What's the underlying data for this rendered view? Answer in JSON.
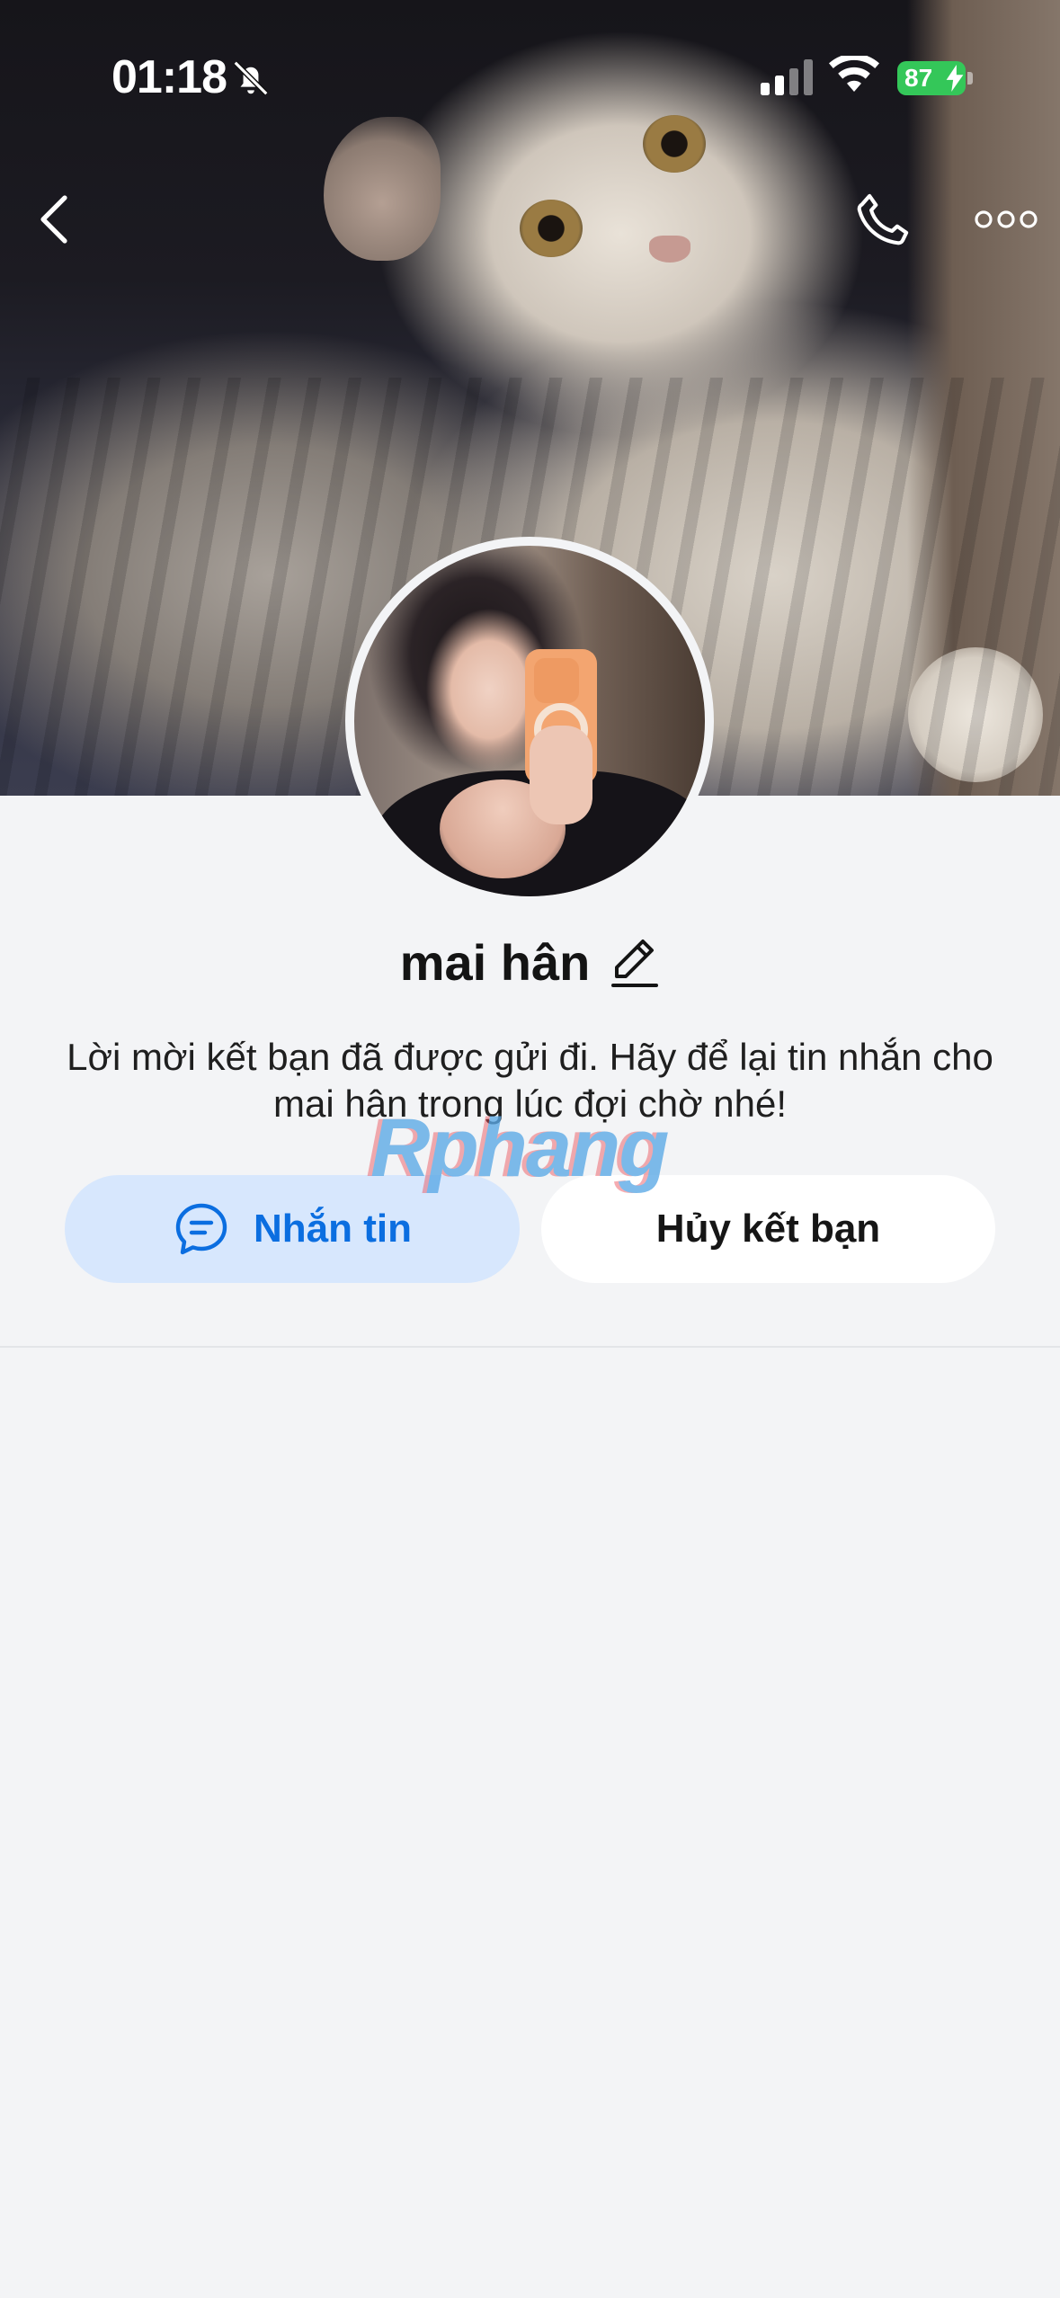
{
  "status_bar": {
    "time": "01:18",
    "battery": "87",
    "colors": {
      "battery": "#34c759"
    }
  },
  "nav": {
    "back_icon": "chevron-left-icon",
    "call_icon": "phone-icon",
    "more_icon": "more-horizontal-icon"
  },
  "profile": {
    "name": "mai hân",
    "message": "Lời mời kết bạn đã được gửi đi. Hãy để lại tin nhắn cho mai hân trong lúc đợi chờ nhé!"
  },
  "watermark": "Rphang",
  "actions": {
    "message_label": "Nhắn tin",
    "unfriend_label": "Hủy kết bạn"
  },
  "colors": {
    "accent": "#0b6ee0",
    "accent_bg": "#d7e7fd",
    "page_bg": "#f3f4f6"
  }
}
